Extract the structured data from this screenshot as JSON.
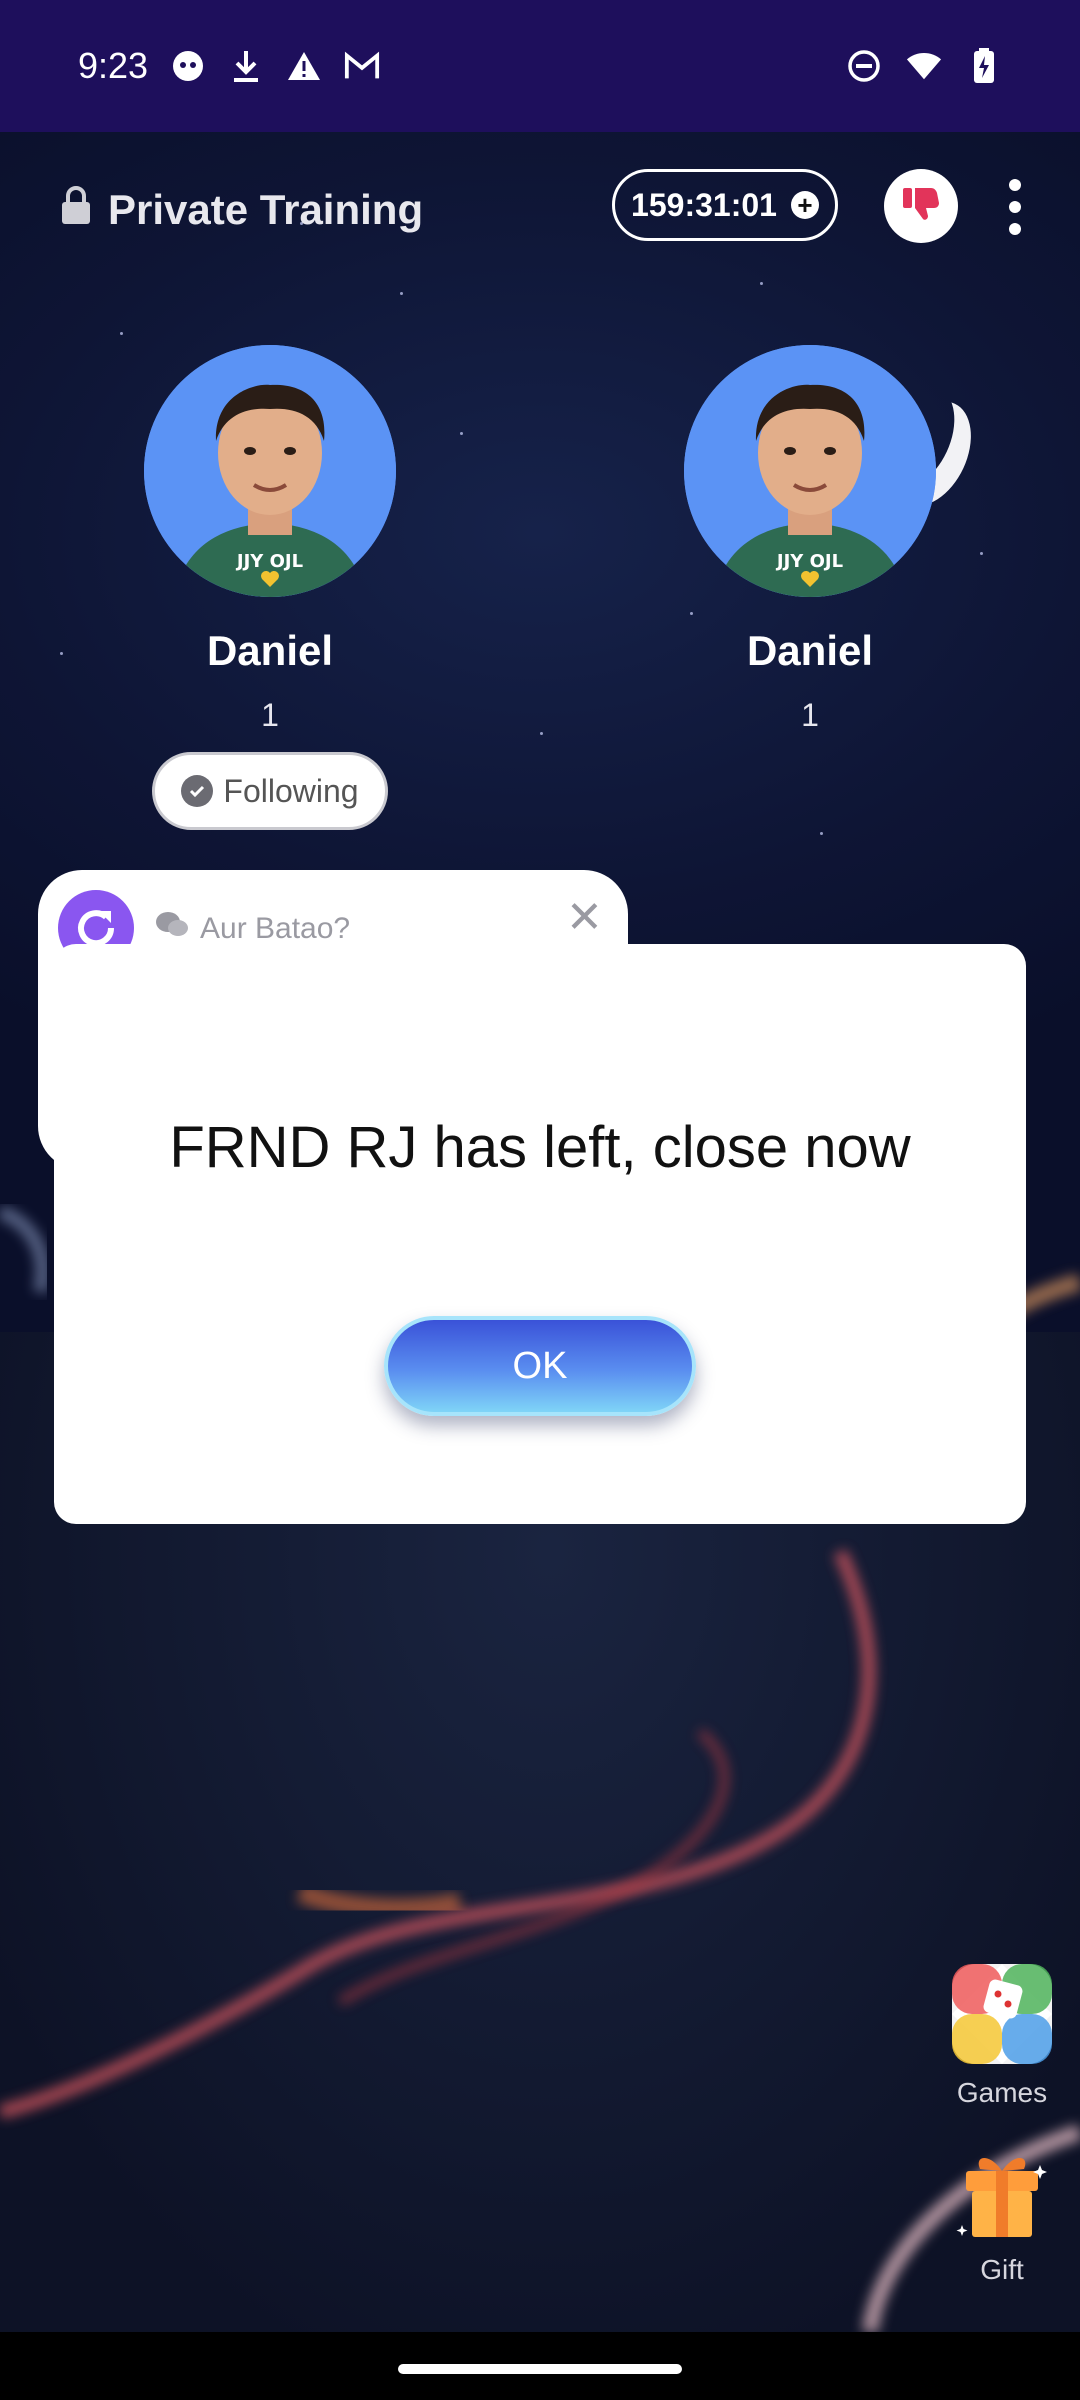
{
  "status_bar": {
    "time": "9:23",
    "left_icons": [
      "face-app-icon",
      "download-icon",
      "warning-icon",
      "gmail-icon"
    ],
    "right_icons": [
      "do-not-disturb-icon",
      "wifi-icon",
      "battery-charging-icon"
    ]
  },
  "header": {
    "room_title": "Private Training",
    "timer": "159:31:01"
  },
  "participants": [
    {
      "name": "Daniel",
      "count": "1"
    },
    {
      "name": "Daniel",
      "count": "1"
    }
  ],
  "follow_button": {
    "label": "Following"
  },
  "background_card": {
    "label": "Aur Batao?"
  },
  "dialog": {
    "message": "FRND RJ has left, close now",
    "ok_label": "OK"
  },
  "floating": {
    "games_label": "Games",
    "gift_label": "Gift"
  },
  "colors": {
    "status_bar_bg": "#1e0f5c",
    "avatar_bg": "#5b93f5",
    "dislike_red": "#e2345a",
    "ok_gradient_top": "#3a52d8",
    "ok_gradient_bottom": "#7fd4f7"
  }
}
